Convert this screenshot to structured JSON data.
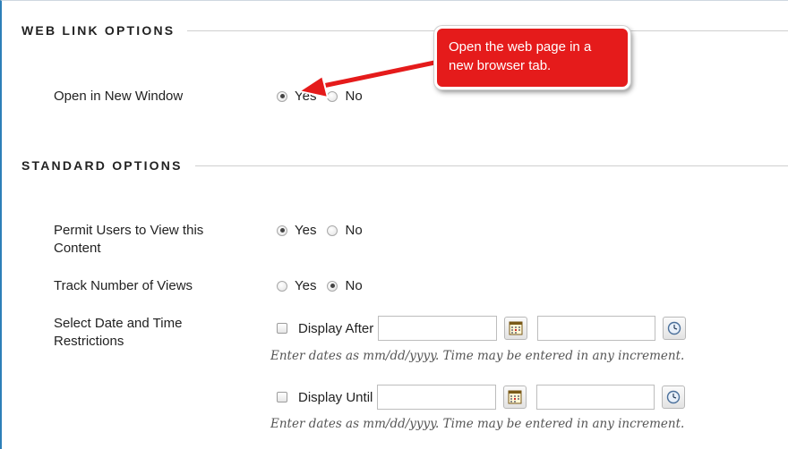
{
  "web_link_options": {
    "title": "WEB LINK OPTIONS",
    "open_new_window": {
      "label": "Open in New Window",
      "yes": "Yes",
      "no": "No",
      "selected": "Yes"
    }
  },
  "standard_options": {
    "title": "STANDARD OPTIONS",
    "permit_view": {
      "label": "Permit Users to View this Content",
      "yes": "Yes",
      "no": "No",
      "selected": "Yes"
    },
    "track_views": {
      "label": "Track Number of Views",
      "yes": "Yes",
      "no": "No",
      "selected": "No"
    },
    "date_restrictions": {
      "label": "Select Date and Time Restrictions",
      "display_after": {
        "label": "Display After",
        "checked": false,
        "date_value": "",
        "time_value": ""
      },
      "display_until": {
        "label": "Display Until",
        "checked": false,
        "date_value": "",
        "time_value": ""
      },
      "hint": "Enter dates as mm/dd/yyyy. Time may be entered in any increment."
    }
  },
  "callout": {
    "text": "Open the web page in a new browser tab.",
    "color": "#e51b1b"
  },
  "icons": {
    "calendar": "calendar-icon",
    "clock": "clock-icon"
  },
  "colors": {
    "frame_border": "#2d7fb8",
    "hint_text": "#555555"
  }
}
